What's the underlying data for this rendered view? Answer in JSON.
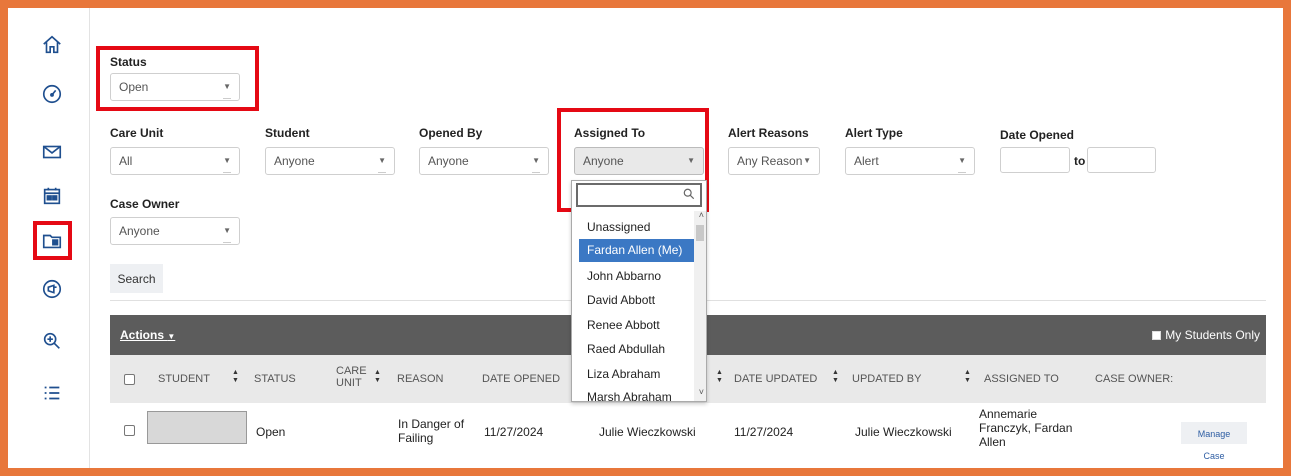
{
  "sidebar": {
    "icons": [
      "home-icon",
      "dashboard-icon",
      "mail-icon",
      "calendar-icon",
      "cases-folder-icon",
      "announcements-icon",
      "zoom-search-icon",
      "list-icon"
    ]
  },
  "filters": {
    "status": {
      "label": "Status",
      "value": "Open"
    },
    "care_unit": {
      "label": "Care Unit",
      "value": "All"
    },
    "student": {
      "label": "Student",
      "value": "Anyone"
    },
    "opened_by": {
      "label": "Opened By",
      "value": "Anyone"
    },
    "assigned_to": {
      "label": "Assigned To",
      "value": "Anyone"
    },
    "alert_reasons": {
      "label": "Alert Reasons",
      "value": "Any Reason"
    },
    "alert_type": {
      "label": "Alert Type",
      "value": "Alert"
    },
    "date_opened": {
      "label": "Date Opened",
      "to_label": "to"
    },
    "case_owner": {
      "label": "Case Owner",
      "value": "Anyone"
    },
    "search_button": "Search"
  },
  "dropdown": {
    "items": [
      "Unassigned",
      "Fardan Allen (Me)",
      "John Abbarno",
      "David Abbott",
      "Renee Abbott",
      "Raed Abdullah",
      "Liza Abraham",
      "Marsh Abraham"
    ],
    "selected_index": 1
  },
  "table": {
    "actions_label": "Actions",
    "my_students_label": "My Students Only",
    "headers": {
      "student": "STUDENT",
      "status": "STATUS",
      "care_unit_1": "CARE",
      "care_unit_2": "UNIT",
      "reason": "REASON",
      "date_opened": "DATE OPENED",
      "date_updated": "DATE UPDATED",
      "updated_by": "UPDATED BY",
      "assigned_to": "ASSIGNED TO",
      "case_owner": "CASE OWNER:"
    },
    "row": {
      "status": "Open",
      "reason_1": "In Danger of",
      "reason_2": "Failing",
      "date_opened": "11/27/2024",
      "opened_by": "Julie Wieczkowski",
      "date_updated": "11/27/2024",
      "updated_by": "Julie Wieczkowski",
      "assigned_1": "Annemarie",
      "assigned_2": "Franczyk, Fardan",
      "assigned_3": "Allen",
      "manage_button": "Manage Case"
    }
  },
  "colors": {
    "frame": "#e8773b",
    "highlight": "#e50914",
    "selected_item": "#3b78c4",
    "actions_bar": "#5c5c5c",
    "icon_blue": "#1f4f8f"
  }
}
